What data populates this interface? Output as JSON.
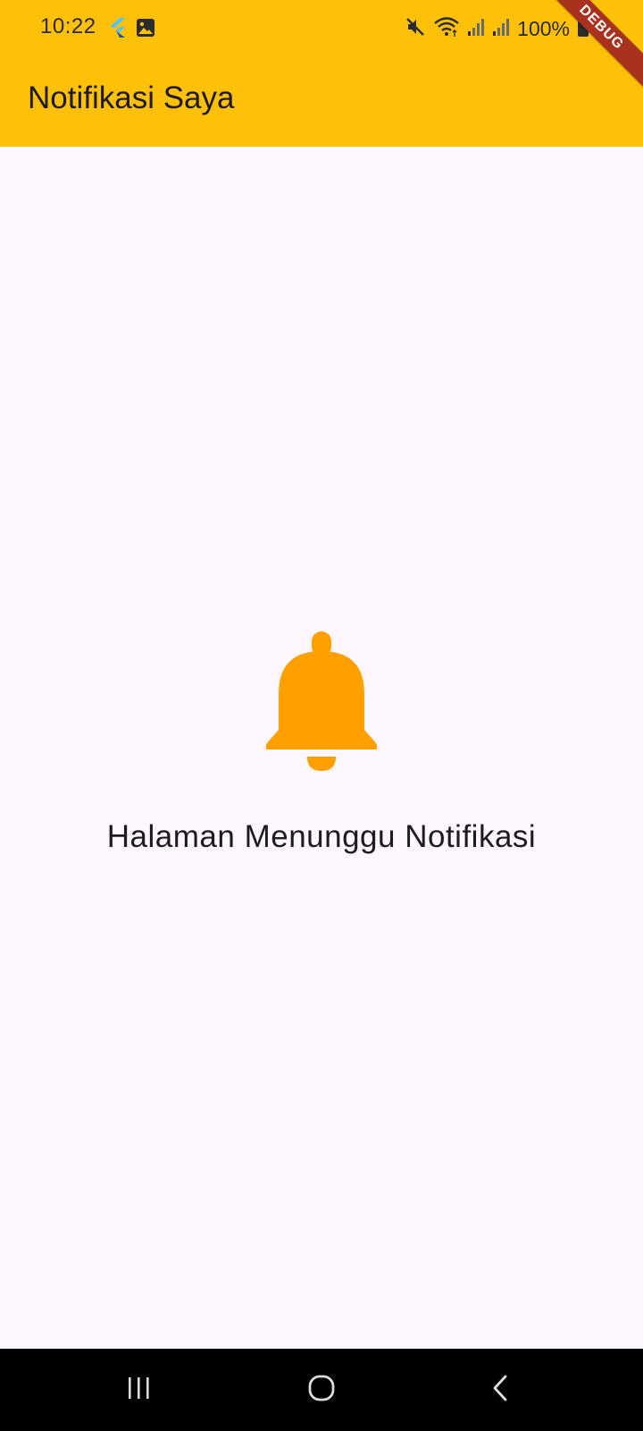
{
  "status_bar": {
    "time": "10:22",
    "battery": "100%",
    "icons": [
      "flutter-icon",
      "image-icon",
      "mute-icon",
      "wifi-icon",
      "signal-icon",
      "signal-icon",
      "battery-icon"
    ]
  },
  "app_bar": {
    "title": "Notifikasi Saya",
    "background": "#ffc107"
  },
  "debug_banner": {
    "label": "DEBUG"
  },
  "main": {
    "icon": "notifications-bell-icon",
    "icon_color": "#ffa000",
    "message": "Halaman Menunggu Notifikasi"
  },
  "navigation_bar": {
    "buttons": [
      "recent-apps-icon",
      "home-icon",
      "back-icon"
    ]
  }
}
